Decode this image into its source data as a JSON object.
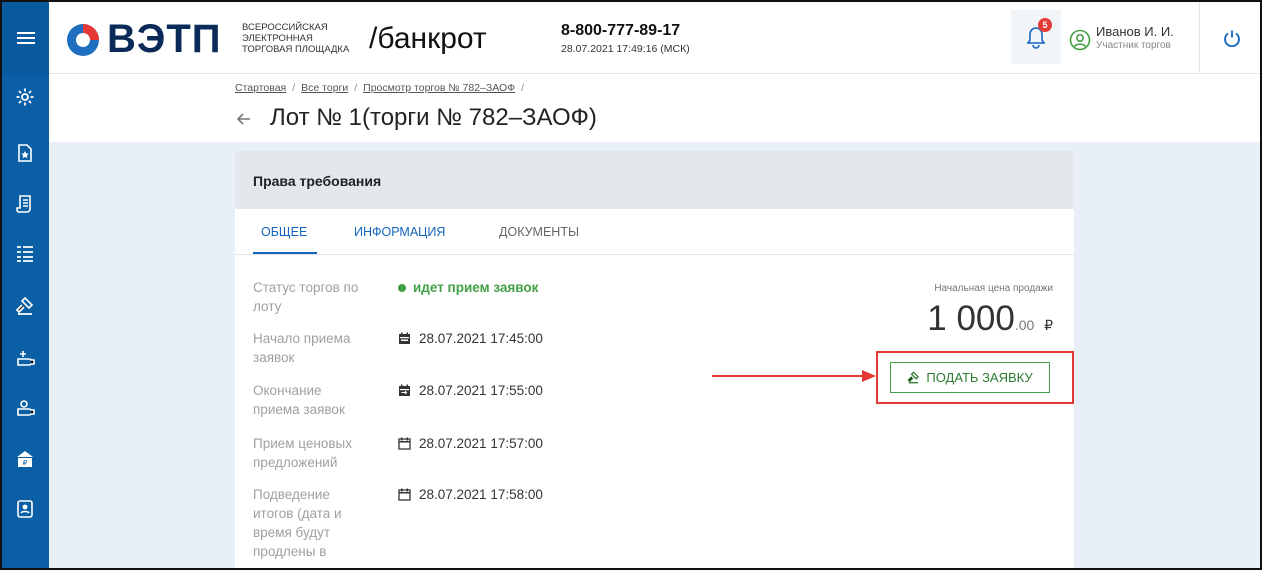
{
  "header": {
    "logo": "ВЭТП",
    "logo_sub_1": "Всероссийская",
    "logo_sub_2": "электронная",
    "logo_sub_3": "торговая площадка",
    "section": "/банкрот",
    "phone": "8-800-777-89-17",
    "datetime": "28.07.2021 17:49:16 (МСК)",
    "notifications_count": "5",
    "user_name": "Иванов И. И.",
    "user_role": "Участник торгов"
  },
  "sidebar": {
    "items": [
      "menu-icon",
      "gear-icon",
      "star-doc-icon",
      "scroll-icon",
      "list-icon",
      "gavel-icon",
      "bid-add-icon",
      "bid-icon",
      "bank-icon",
      "contacts-icon"
    ]
  },
  "breadcrumb": {
    "items": [
      "Стартовая",
      "Все торги",
      "Просмотр торгов № 782–ЗАОФ"
    ]
  },
  "page": {
    "title": "Лот № 1(торги № 782–ЗАОФ)"
  },
  "card": {
    "title": "Права требования",
    "tabs": [
      "ОБЩЕЕ",
      "ИНФОРМАЦИЯ",
      "ДОКУМЕНТЫ"
    ],
    "status_label_1": "Статус торгов по",
    "status_label_2": "лоту",
    "status_value": "идет прием заявок",
    "rows": [
      {
        "label_1": "Начало приема",
        "label_2": "заявок",
        "value": "28.07.2021 17:45:00"
      },
      {
        "label_1": "Окончание",
        "label_2": "приема заявок",
        "value": "28.07.2021 17:55:00"
      },
      {
        "label_1": "Прием ценовых",
        "label_2": "предложений",
        "value": "28.07.2021 17:57:00"
      },
      {
        "label_1": "Подведение",
        "label_2": "итогов (дата и",
        "label_3": "время будут",
        "label_4": "продлены в",
        "value": "28.07.2021 17:58:00"
      }
    ],
    "price_label": "Начальная цена продажи",
    "price_main": "1 000",
    "price_cents": ".00",
    "price_currency": "₽",
    "apply_button": "ПОДАТЬ ЗАЯВКУ"
  },
  "colors": {
    "sidebar": "#0b5fa5",
    "accent": "#1565c0",
    "status_green": "#43a047",
    "highlight_red": "#e53935"
  }
}
